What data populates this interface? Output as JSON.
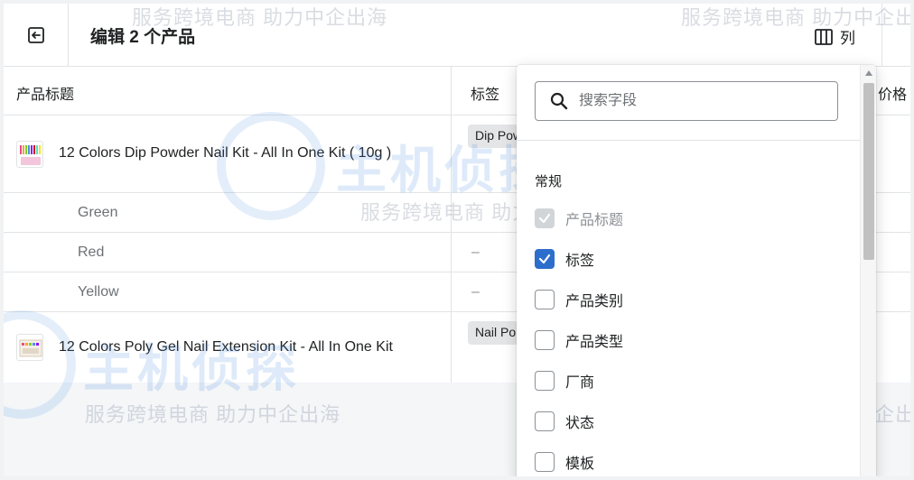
{
  "header": {
    "title": "编辑 2 个产品",
    "columns_label": "列"
  },
  "table": {
    "headers": {
      "title": "产品标题",
      "tags": "标签",
      "price": "价格"
    },
    "rows": [
      {
        "type": "product",
        "title": "12 Colors Dip Powder Nail Kit - All In One Kit ( 10g )",
        "tag": "Dip Powder"
      },
      {
        "type": "variant",
        "title": "Green",
        "tag": ""
      },
      {
        "type": "variant",
        "title": "Red",
        "tag": "–"
      },
      {
        "type": "variant",
        "title": "Yellow",
        "tag": "–"
      },
      {
        "type": "product",
        "title": "12 Colors Poly Gel Nail Extension Kit - All In One Kit",
        "tag": "Nail Polish"
      }
    ]
  },
  "popover": {
    "search_placeholder": "搜索字段",
    "section_title": "常规",
    "options": [
      {
        "label": "产品标题",
        "state": "disabled-checked"
      },
      {
        "label": "标签",
        "state": "checked"
      },
      {
        "label": "产品类别",
        "state": "unchecked"
      },
      {
        "label": "产品类型",
        "state": "unchecked"
      },
      {
        "label": "厂商",
        "state": "unchecked"
      },
      {
        "label": "状态",
        "state": "unchecked"
      },
      {
        "label": "模板",
        "state": "unchecked"
      }
    ]
  },
  "watermark": {
    "text": "服务跨境电商 助力中企出海",
    "brand": "主机侦探"
  },
  "colors": {
    "accent": "#2c6ecb",
    "border": "#e1e3e5",
    "text": "#202223",
    "subdued": "#6d7175"
  }
}
